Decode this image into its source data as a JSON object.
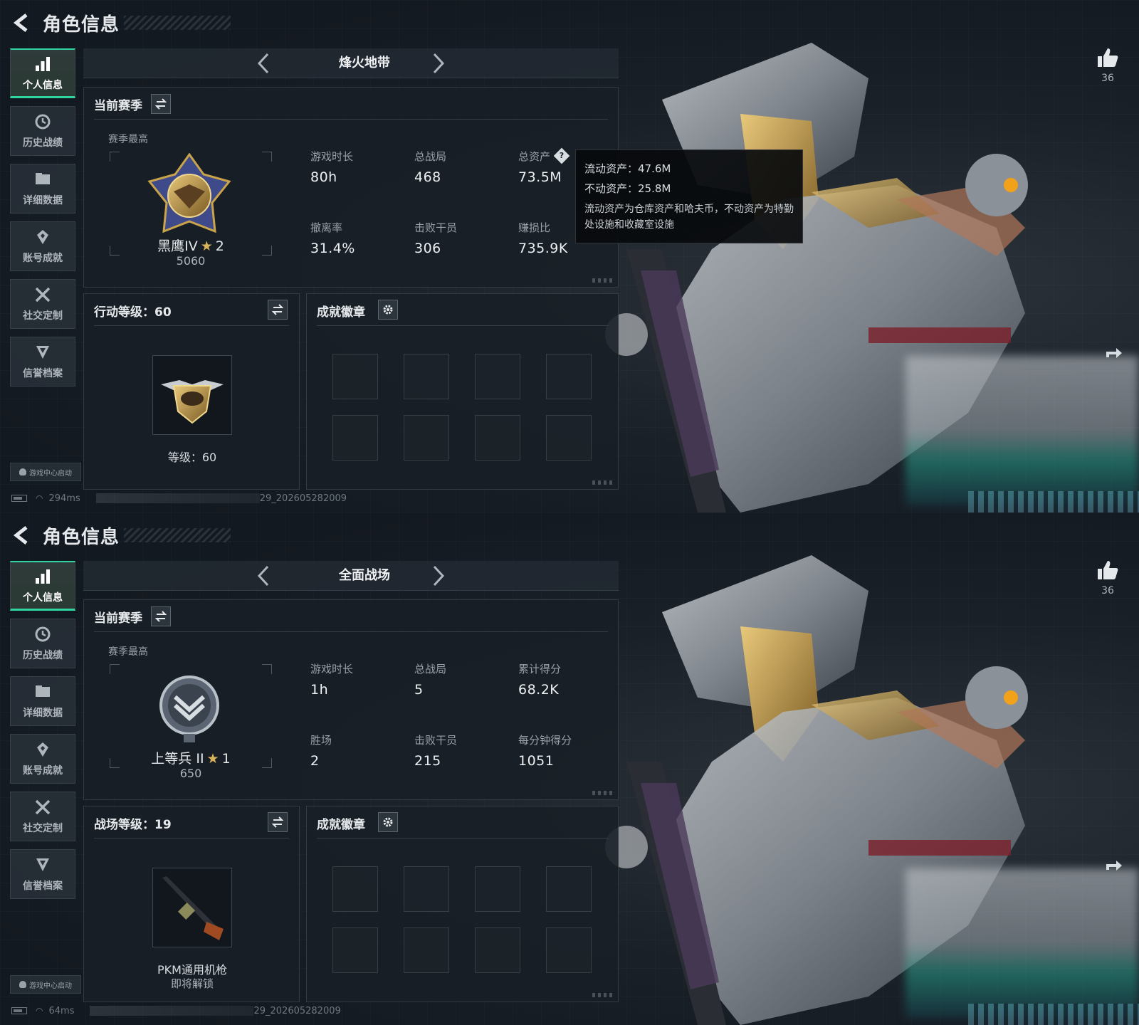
{
  "screens": [
    {
      "page_title": "角色信息",
      "sidebar": [
        {
          "label": "个人信息",
          "icon": "bar-chart-icon",
          "active": true
        },
        {
          "label": "历史战绩",
          "icon": "history-icon",
          "active": false
        },
        {
          "label": "详细数据",
          "icon": "folder-icon",
          "active": false
        },
        {
          "label": "账号成就",
          "icon": "achievement-icon",
          "active": false
        },
        {
          "label": "社交定制",
          "icon": "tools-icon",
          "active": false
        },
        {
          "label": "信誉档案",
          "icon": "credit-icon",
          "active": false
        }
      ],
      "launch_badge": "游戏中心启动",
      "status": {
        "ping": "294ms",
        "build": "29_202605282009"
      },
      "mode": "烽火地带",
      "season": {
        "heading": "当前赛季",
        "sub_label": "赛季最高",
        "rank_name": "黑鹰IV",
        "rank_stars": "2",
        "rank_score": "5060",
        "stats": [
          {
            "label": "游戏时长",
            "value": "80h"
          },
          {
            "label": "总战局",
            "value": "468"
          },
          {
            "label": "总资产",
            "value": "73.5M"
          },
          {
            "label": "撤离率",
            "value": "31.4%"
          },
          {
            "label": "击败干员",
            "value": "306"
          },
          {
            "label": "赚损比",
            "value": "735.9K"
          }
        ]
      },
      "tooltip": {
        "line1": "流动资产：47.6M",
        "line2": "不动资产：25.8M",
        "desc": "流动资产为仓库资产和哈夫币，不动资产为特勤处设施和收藏室设施"
      },
      "level_card": {
        "heading": "行动等级：60",
        "caption": "等级：60",
        "caption2": ""
      },
      "badge_card": {
        "heading": "成就徽章"
      },
      "likes": "36"
    },
    {
      "page_title": "角色信息",
      "sidebar": [
        {
          "label": "个人信息",
          "icon": "bar-chart-icon",
          "active": true
        },
        {
          "label": "历史战绩",
          "icon": "history-icon",
          "active": false
        },
        {
          "label": "详细数据",
          "icon": "folder-icon",
          "active": false
        },
        {
          "label": "账号成就",
          "icon": "achievement-icon",
          "active": false
        },
        {
          "label": "社交定制",
          "icon": "tools-icon",
          "active": false
        },
        {
          "label": "信誉档案",
          "icon": "credit-icon",
          "active": false
        }
      ],
      "launch_badge": "游戏中心启动",
      "status": {
        "ping": "64ms",
        "build": "29_202605282009"
      },
      "mode": "全面战场",
      "season": {
        "heading": "当前赛季",
        "sub_label": "赛季最高",
        "rank_name": "上等兵 II",
        "rank_stars": "1",
        "rank_score": "650",
        "stats": [
          {
            "label": "游戏时长",
            "value": "1h"
          },
          {
            "label": "总战局",
            "value": "5"
          },
          {
            "label": "累计得分",
            "value": "68.2K"
          },
          {
            "label": "胜场",
            "value": "2"
          },
          {
            "label": "击败干员",
            "value": "215"
          },
          {
            "label": "每分钟得分",
            "value": "1051"
          }
        ]
      },
      "level_card": {
        "heading": "战场等级：19",
        "caption": "PKM通用机枪",
        "caption2": "即将解锁"
      },
      "badge_card": {
        "heading": "成就徽章"
      },
      "likes": "36"
    }
  ],
  "colors": {
    "accent": "#2fd4a0",
    "panel_bg": "#181f26",
    "text": "#d8dde2",
    "gold": "#d8b45a"
  }
}
